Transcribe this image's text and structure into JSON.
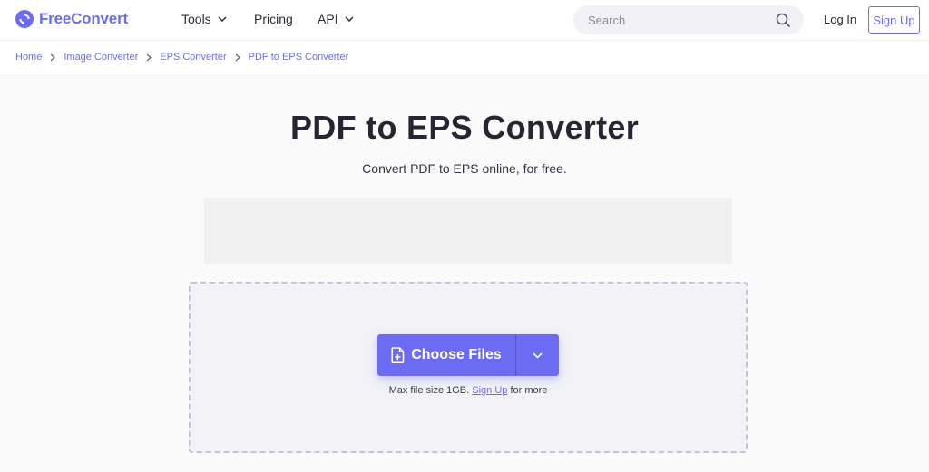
{
  "brand": {
    "name_part1": "Free",
    "name_part2": "Convert"
  },
  "nav": {
    "tools": "Tools",
    "pricing": "Pricing",
    "api": "API"
  },
  "search": {
    "placeholder": "Search"
  },
  "auth": {
    "login": "Log In",
    "signup": "Sign Up"
  },
  "breadcrumb": [
    "Home",
    "Image Converter",
    "EPS Converter",
    "PDF to EPS Converter"
  ],
  "hero": {
    "title": "PDF to EPS Converter",
    "subtitle": "Convert PDF to EPS online, for free."
  },
  "upload": {
    "button_label": "Choose Files",
    "note_prefix": "Max file size 1GB.",
    "note_link": "Sign Up",
    "note_suffix": "for more"
  },
  "colors": {
    "accent": "#6c6cf2",
    "dropzone_bg": "#f2f2f7",
    "dropzone_border": "#c5c2db"
  },
  "icons": [
    "logo-icon",
    "chevron-down-icon",
    "search-icon",
    "chevron-right-icon",
    "file-add-icon"
  ]
}
